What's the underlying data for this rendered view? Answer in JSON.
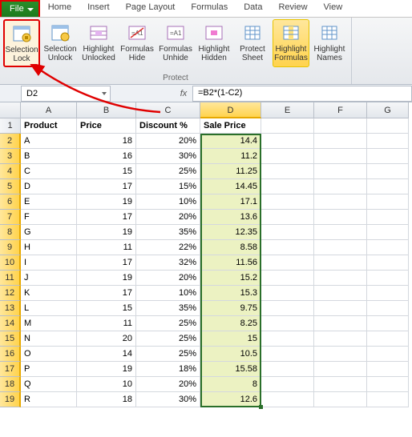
{
  "tabs": {
    "file": "File",
    "home": "Home",
    "insert": "Insert",
    "pagelayout": "Page Layout",
    "formulas": "Formulas",
    "data": "Data",
    "review": "Review",
    "view": "View"
  },
  "ribbon": {
    "btns": {
      "sellock": "Selection Lock",
      "selunlock": "Selection Unlock",
      "hlunlocked": "Highlight Unlocked",
      "fhide": "Formulas Hide",
      "funhide": "Formulas Unhide",
      "hlhidden": "Highlight Hidden",
      "protect": "Protect Sheet",
      "hlformulas": "Highlight Formulas",
      "hlnames": "Highlight Names"
    },
    "group": "Protect"
  },
  "namebox": "D2",
  "fx": "fx",
  "formula": "=B2*(1-C2)",
  "cols": [
    "A",
    "B",
    "C",
    "D",
    "E",
    "F",
    "G"
  ],
  "headers": {
    "A": "Product",
    "B": "Price",
    "C": "Discount %",
    "D": "Sale Price"
  },
  "rows": [
    {
      "n": 2,
      "A": "A",
      "B": "18",
      "C": "20%",
      "D": "14.4"
    },
    {
      "n": 3,
      "A": "B",
      "B": "16",
      "C": "30%",
      "D": "11.2"
    },
    {
      "n": 4,
      "A": "C",
      "B": "15",
      "C": "25%",
      "D": "11.25"
    },
    {
      "n": 5,
      "A": "D",
      "B": "17",
      "C": "15%",
      "D": "14.45"
    },
    {
      "n": 6,
      "A": "E",
      "B": "19",
      "C": "10%",
      "D": "17.1"
    },
    {
      "n": 7,
      "A": "F",
      "B": "17",
      "C": "20%",
      "D": "13.6"
    },
    {
      "n": 8,
      "A": "G",
      "B": "19",
      "C": "35%",
      "D": "12.35"
    },
    {
      "n": 9,
      "A": "H",
      "B": "11",
      "C": "22%",
      "D": "8.58"
    },
    {
      "n": 10,
      "A": "I",
      "B": "17",
      "C": "32%",
      "D": "11.56"
    },
    {
      "n": 11,
      "A": "J",
      "B": "19",
      "C": "20%",
      "D": "15.2"
    },
    {
      "n": 12,
      "A": "K",
      "B": "17",
      "C": "10%",
      "D": "15.3"
    },
    {
      "n": 13,
      "A": "L",
      "B": "15",
      "C": "35%",
      "D": "9.75"
    },
    {
      "n": 14,
      "A": "M",
      "B": "11",
      "C": "25%",
      "D": "8.25"
    },
    {
      "n": 15,
      "A": "N",
      "B": "20",
      "C": "25%",
      "D": "15"
    },
    {
      "n": 16,
      "A": "O",
      "B": "14",
      "C": "25%",
      "D": "10.5"
    },
    {
      "n": 17,
      "A": "P",
      "B": "19",
      "C": "18%",
      "D": "15.58"
    },
    {
      "n": 18,
      "A": "Q",
      "B": "10",
      "C": "20%",
      "D": "8"
    },
    {
      "n": 19,
      "A": "R",
      "B": "18",
      "C": "30%",
      "D": "12.6"
    }
  ],
  "chart_data": {
    "type": "table",
    "title": "",
    "columns": [
      "Product",
      "Price",
      "Discount %",
      "Sale Price"
    ],
    "data": [
      [
        "A",
        18,
        0.2,
        14.4
      ],
      [
        "B",
        16,
        0.3,
        11.2
      ],
      [
        "C",
        15,
        0.25,
        11.25
      ],
      [
        "D",
        17,
        0.15,
        14.45
      ],
      [
        "E",
        19,
        0.1,
        17.1
      ],
      [
        "F",
        17,
        0.2,
        13.6
      ],
      [
        "G",
        19,
        0.35,
        12.35
      ],
      [
        "H",
        11,
        0.22,
        8.58
      ],
      [
        "I",
        17,
        0.32,
        11.56
      ],
      [
        "J",
        19,
        0.2,
        15.2
      ],
      [
        "K",
        17,
        0.1,
        15.3
      ],
      [
        "L",
        15,
        0.35,
        9.75
      ],
      [
        "M",
        11,
        0.25,
        8.25
      ],
      [
        "N",
        20,
        0.25,
        15
      ],
      [
        "O",
        14,
        0.25,
        10.5
      ],
      [
        "P",
        19,
        0.18,
        15.58
      ],
      [
        "Q",
        10,
        0.2,
        8
      ],
      [
        "R",
        18,
        0.3,
        12.6
      ]
    ]
  }
}
